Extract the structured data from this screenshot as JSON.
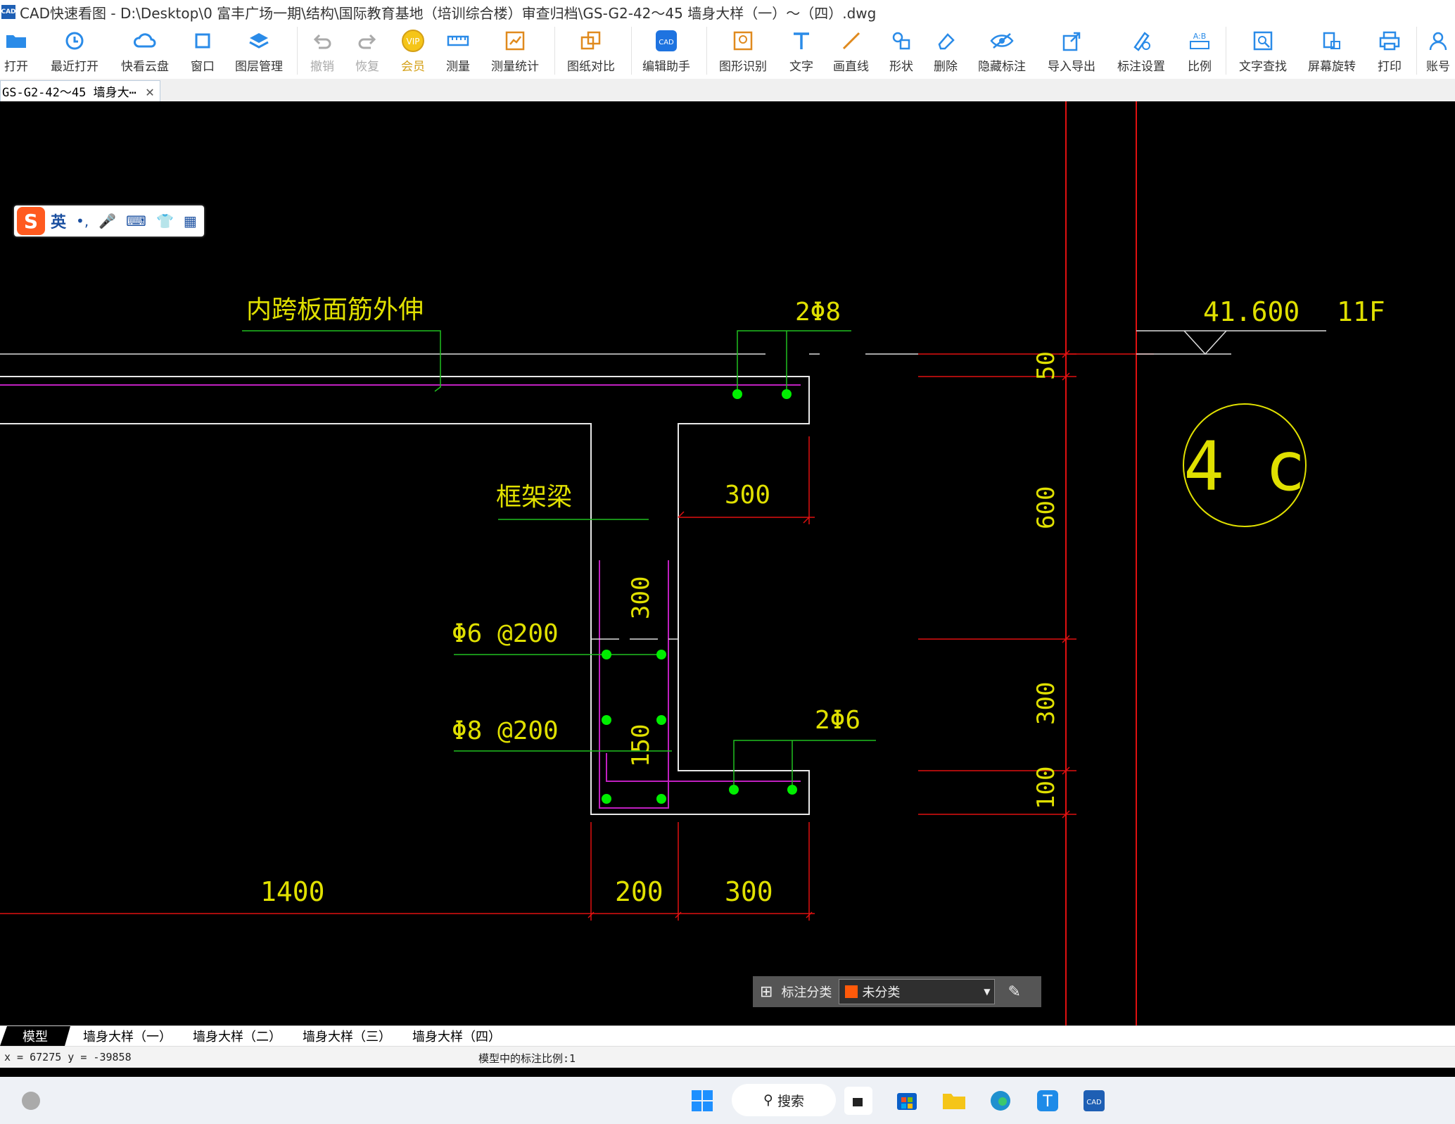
{
  "window": {
    "title": "CAD快速看图 - D:\\Desktop\\0 富丰广场一期\\结构\\国际教育基地（培训综合楼）审查归档\\GS-G2-42～45 墙身大样（一）～（四）.dwg",
    "app_icon": "CAD"
  },
  "toolbar": {
    "items": [
      {
        "label": "打开",
        "icon": "folder-icon"
      },
      {
        "label": "最近打开",
        "icon": "history-icon"
      },
      {
        "label": "快看云盘",
        "icon": "cloud-icon"
      },
      {
        "label": "窗口",
        "icon": "window-icon"
      },
      {
        "label": "图层管理",
        "icon": "layers-icon"
      },
      {
        "label": "撤销",
        "icon": "undo-icon"
      },
      {
        "label": "恢复",
        "icon": "redo-icon"
      },
      {
        "label": "会员",
        "icon": "vip-icon"
      },
      {
        "label": "测量",
        "icon": "ruler-icon"
      },
      {
        "label": "测量统计",
        "icon": "measure-stats-icon"
      },
      {
        "label": "图纸对比",
        "icon": "compare-icon"
      },
      {
        "label": "编辑助手",
        "icon": "edit-assistant-icon"
      },
      {
        "label": "图形识别",
        "icon": "shape-recognize-icon"
      },
      {
        "label": "文字",
        "icon": "text-icon"
      },
      {
        "label": "画直线",
        "icon": "line-icon"
      },
      {
        "label": "形状",
        "icon": "shape-icon"
      },
      {
        "label": "删除",
        "icon": "eraser-icon"
      },
      {
        "label": "隐藏标注",
        "icon": "eye-hide-icon"
      },
      {
        "label": "导入导出",
        "icon": "import-export-icon"
      },
      {
        "label": "标注设置",
        "icon": "annotation-settings-icon"
      },
      {
        "label": "比例",
        "icon": "scale-icon"
      },
      {
        "label": "文字查找",
        "icon": "text-search-icon"
      },
      {
        "label": "屏幕旋转",
        "icon": "rotate-screen-icon"
      },
      {
        "label": "打印",
        "icon": "printer-icon"
      },
      {
        "label": "账号",
        "icon": "account-icon"
      }
    ]
  },
  "doc_tab": {
    "label": "GS-G2-42～45 墙身大⋯"
  },
  "ime": {
    "lang": "英"
  },
  "drawing": {
    "labels": {
      "slab_rebar": "内跨板面筋外伸",
      "frame_beam": "框架梁",
      "top_bars": "2Φ8",
      "stirrup1": "Φ6 @200",
      "stirrup2": "Φ8 @200",
      "bottom_bars": "2Φ6",
      "elevation": "41.600",
      "floor": "11F",
      "axis": "4 c"
    },
    "dims": {
      "d300a": "300",
      "d300b": "300",
      "d150": "150",
      "d1400": "1400",
      "d200": "200",
      "d300c": "300",
      "v50": "50",
      "v600": "600",
      "v300": "300",
      "v100": "100"
    }
  },
  "annotation_panel": {
    "label": "标注分类",
    "selected": "未分类",
    "swatch_color": "#ff5a0a"
  },
  "sheets": {
    "tabs": [
      "模型",
      "墙身大样（一）",
      "墙身大样（二）",
      "墙身大样（三）",
      "墙身大样（四）"
    ]
  },
  "status": {
    "coords": "x = 67275  y = -39858",
    "scale": "模型中的标注比例:1"
  },
  "taskbar": {
    "search": "搜索"
  }
}
